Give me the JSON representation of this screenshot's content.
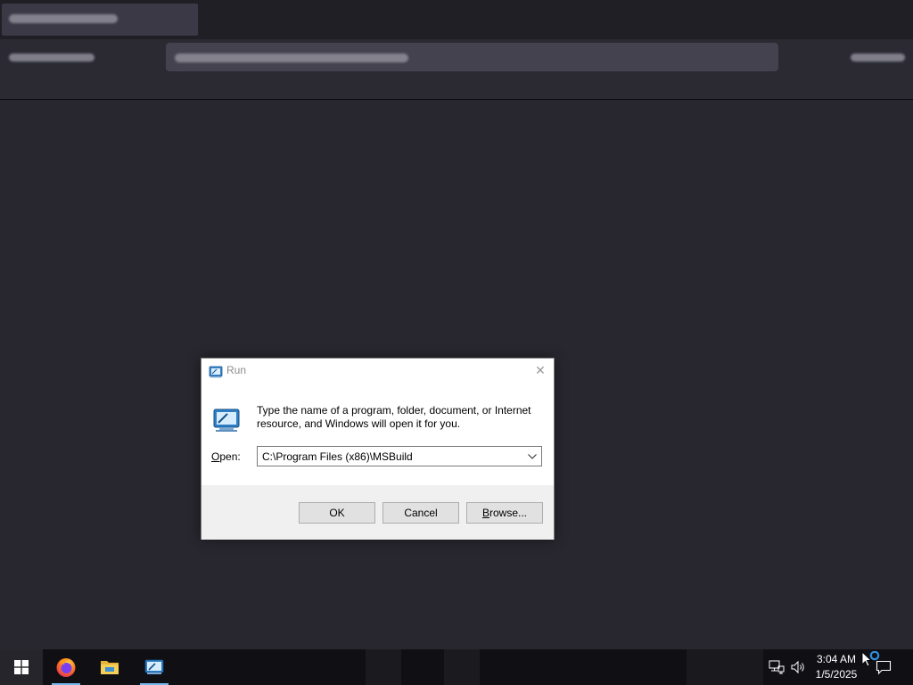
{
  "dialog": {
    "title": "Run",
    "description": "Type the name of a program, folder, document, or Internet resource, and Windows will open it for you.",
    "open_label_underline": "O",
    "open_label_rest": "pen:",
    "open_value": "C:\\Program Files (x86)\\MSBuild",
    "close_glyph": "✕",
    "buttons": {
      "ok": "OK",
      "cancel": "Cancel",
      "browse_underline": "B",
      "browse_rest": "rowse..."
    }
  },
  "taskbar": {
    "apps": [
      {
        "name": "Firefox",
        "icon": "firefox-icon"
      },
      {
        "name": "File Explorer",
        "icon": "folder-icon"
      },
      {
        "name": "Run",
        "icon": "run-icon"
      }
    ],
    "clock": {
      "time": "3:04 AM",
      "date": "1/5/2025"
    }
  },
  "colors": {
    "app_background": "#28272f",
    "taskbar": "#101014",
    "taskbar_accent": "#76b9ed",
    "dialog_footer": "#f0f0f0",
    "button": "#e1e1e1"
  }
}
